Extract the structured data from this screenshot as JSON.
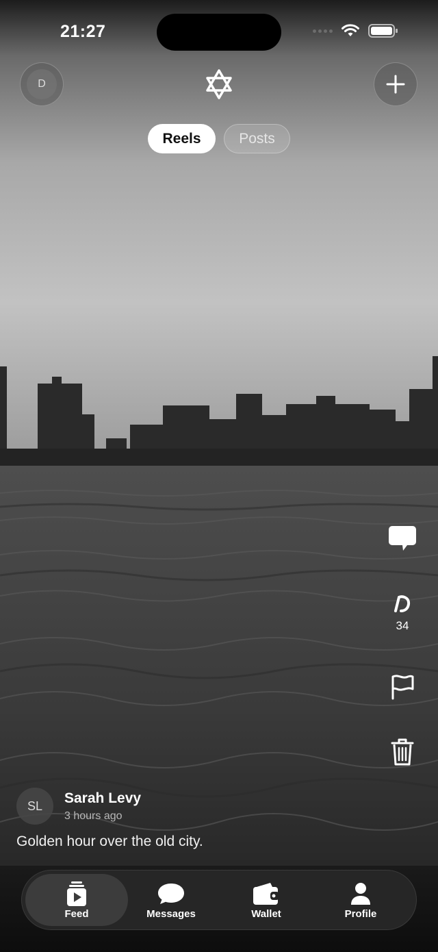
{
  "status_bar": {
    "time": "21:27"
  },
  "header": {
    "avatar_initial": "D",
    "logo_icon": "star-of-david-icon",
    "add_icon": "plus-icon"
  },
  "tabs": [
    {
      "label": "Reels",
      "active": true
    },
    {
      "label": "Posts",
      "active": false
    }
  ],
  "actions": {
    "comment_icon": "comment-icon",
    "tip_icon": "mem-currency-icon",
    "tip_count": "34",
    "report_icon": "flag-icon",
    "delete_icon": "trash-icon"
  },
  "post": {
    "author_initials": "SL",
    "author_name": "Sarah Levy",
    "time_ago": "3 hours ago",
    "caption": "Golden hour over the old city."
  },
  "nav": [
    {
      "label": "Feed",
      "icon": "feed-icon",
      "active": true
    },
    {
      "label": "Messages",
      "icon": "messages-icon",
      "active": false
    },
    {
      "label": "Wallet",
      "icon": "wallet-icon",
      "active": false
    },
    {
      "label": "Profile",
      "icon": "profile-icon",
      "active": false
    }
  ]
}
